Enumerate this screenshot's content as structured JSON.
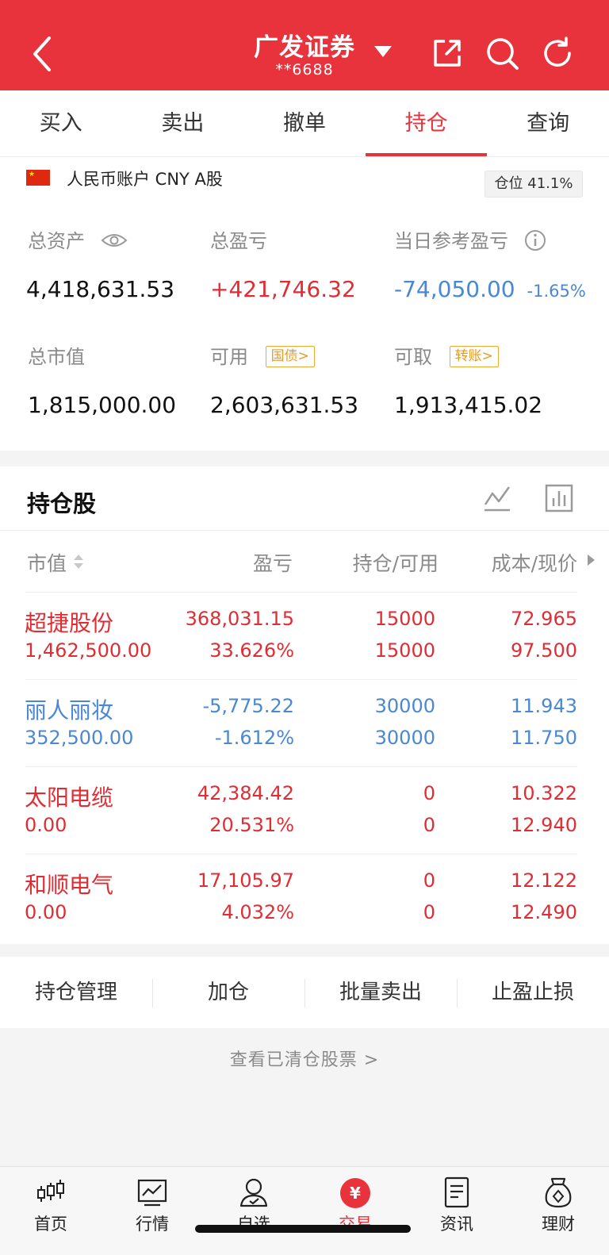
{
  "header": {
    "title": "广发证券",
    "account": "**6688"
  },
  "tabs": [
    {
      "label": "买入"
    },
    {
      "label": "卖出"
    },
    {
      "label": "撤单"
    },
    {
      "label": "持仓",
      "active": true
    },
    {
      "label": "查询"
    }
  ],
  "account": {
    "type": "人民币账户 CNY A股",
    "position_badge": "仓位 41.1%",
    "total_assets_label": "总资产",
    "total_assets": "4,418,631.53",
    "total_pl_label": "总盈亏",
    "total_pl": "+421,746.32",
    "daily_pl_label": "当日参考盈亏",
    "daily_pl": "-74,050.00",
    "daily_pl_pct": "-1.65%",
    "market_value_label": "总市值",
    "market_value": "1,815,000.00",
    "available_label": "可用",
    "available_tag": "国债>",
    "available": "2,603,631.53",
    "withdrawable_label": "可取",
    "withdrawable_tag": "转账>",
    "withdrawable": "1,913,415.02"
  },
  "holdings": {
    "title": "持仓股",
    "columns": [
      "市值",
      "盈亏",
      "持仓/可用",
      "成本/现价"
    ],
    "rows": [
      {
        "name": "超捷股份",
        "market_value": "1,462,500.00",
        "pl": "368,031.15",
        "pl_pct": "33.626%",
        "hold": "15000",
        "avail": "15000",
        "cost": "72.965",
        "price": "97.500",
        "color": "#e02d34"
      },
      {
        "name": "丽人丽妆",
        "market_value": "352,500.00",
        "pl": "-5,775.22",
        "pl_pct": "-1.612%",
        "hold": "30000",
        "avail": "30000",
        "cost": "11.943",
        "price": "11.750",
        "color": "#4a88d4"
      },
      {
        "name": "太阳电缆",
        "market_value": "0.00",
        "pl": "42,384.42",
        "pl_pct": "20.531%",
        "hold": "0",
        "avail": "0",
        "cost": "10.322",
        "price": "12.940",
        "color": "#e02d34"
      },
      {
        "name": "和顺电气",
        "market_value": "0.00",
        "pl": "17,105.97",
        "pl_pct": "4.032%",
        "hold": "0",
        "avail": "0",
        "cost": "12.122",
        "price": "12.490",
        "color": "#e02d34"
      }
    ]
  },
  "actions": [
    {
      "label": "持仓管理"
    },
    {
      "label": "加仓"
    },
    {
      "label": "批量卖出"
    },
    {
      "label": "止盈止损"
    }
  ],
  "cleared_link": "查看已清仓股票 >",
  "bottom_nav": [
    {
      "label": "首页",
      "icon": "candlestick-icon"
    },
    {
      "label": "行情",
      "icon": "market-chart-icon"
    },
    {
      "label": "自选",
      "icon": "watchlist-person-icon"
    },
    {
      "label": "交易",
      "icon": "yen-trade-icon",
      "active": true
    },
    {
      "label": "资讯",
      "icon": "news-document-icon"
    },
    {
      "label": "理财",
      "icon": "money-bag-icon"
    }
  ],
  "colors": {
    "brand_red": "#e8323c",
    "gain": "#e02d34",
    "loss": "#4a88d4",
    "tag_orange": "#e99a20"
  }
}
